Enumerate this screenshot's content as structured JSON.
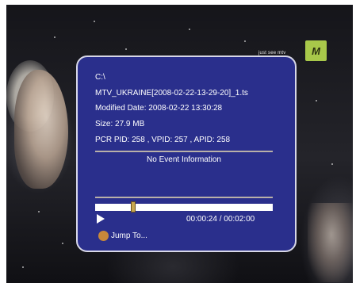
{
  "overlay": {
    "channel_tag": "just see mtv",
    "logo_text": "M"
  },
  "info": {
    "path": "C:\\",
    "filename": "MTV_UKRAINE[2008-02-22-13-29-20]_1.ts",
    "modified_date": "Modified Date: 2008-02-22 13:30:28",
    "size": "Size: 27.9 MB",
    "pids": "PCR PID: 258 , VPID: 257 , APID: 258",
    "event": "No Event Information"
  },
  "playback": {
    "progress_fraction": 0.2,
    "time": "00:00:24 / 00:02:00",
    "jump_label": "Jump To...",
    "jump_color": "#c8883a"
  },
  "colors": {
    "panel": "#2a2f8c",
    "separator": "#b8b0a8"
  }
}
